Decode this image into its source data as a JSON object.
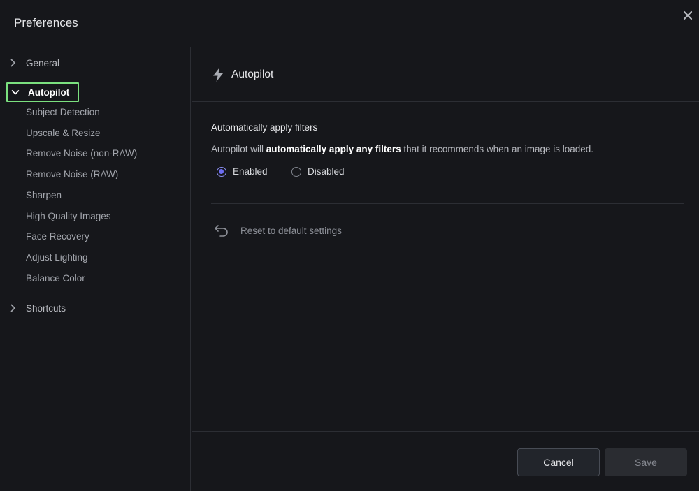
{
  "window": {
    "title": "Preferences",
    "close_icon": "close-icon"
  },
  "sidebar": {
    "groups": [
      {
        "label": "General",
        "expanded": false
      },
      {
        "label": "Autopilot",
        "expanded": true,
        "selected": true
      },
      {
        "label": "Shortcuts",
        "expanded": false
      }
    ],
    "autopilot_items": [
      "Subject Detection",
      "Upscale & Resize",
      "Remove Noise (non-RAW)",
      "Remove Noise (RAW)",
      "Sharpen",
      "High Quality Images",
      "Face Recovery",
      "Adjust Lighting",
      "Balance Color"
    ]
  },
  "main": {
    "section_title": "Autopilot",
    "section_icon": "lightning-icon",
    "setting": {
      "title": "Automatically apply filters",
      "desc_prefix": "Autopilot will ",
      "desc_bold": "automatically apply any filters",
      "desc_suffix": " that it recommends when an image is loaded.",
      "options": [
        {
          "label": "Enabled",
          "selected": true
        },
        {
          "label": "Disabled",
          "selected": false
        }
      ]
    },
    "reset_label": "Reset to default settings"
  },
  "footer": {
    "cancel_label": "Cancel",
    "save_label": "Save"
  },
  "colors": {
    "background": "#16171b",
    "highlight": "#7be07f",
    "radio_accent": "#6d6df2"
  }
}
